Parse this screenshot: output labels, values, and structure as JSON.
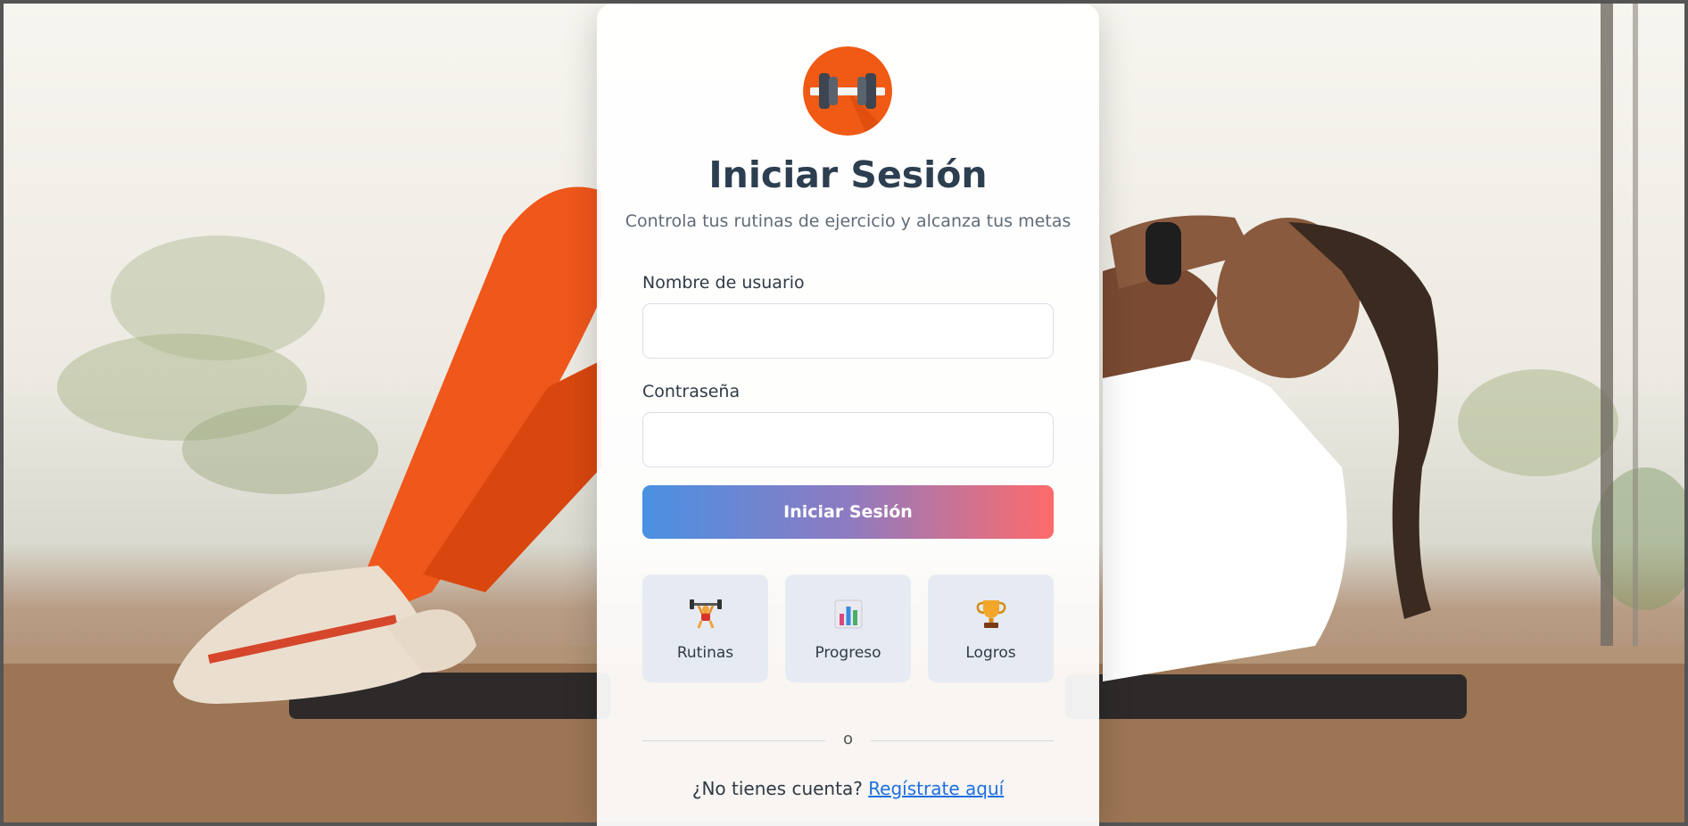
{
  "login": {
    "title": "Iniciar Sesión",
    "subtitle": "Controla tus rutinas de ejercicio y alcanza tus metas",
    "username_label": "Nombre de usuario",
    "username_value": "",
    "password_label": "Contraseña",
    "password_value": "",
    "submit_label": "Iniciar Sesión"
  },
  "features": [
    {
      "label": "Rutinas",
      "icon": "weightlifter-icon"
    },
    {
      "label": "Progreso",
      "icon": "bar-chart-icon"
    },
    {
      "label": "Logros",
      "icon": "trophy-icon"
    }
  ],
  "divider": {
    "text": "o"
  },
  "footer": {
    "question": "¿No tienes cuenta?",
    "link": "Regístrate aquí"
  },
  "colors": {
    "title": "#2c3e50",
    "link": "#1d6fe0",
    "button_gradient_start": "#4a90e2",
    "button_gradient_end": "#ff6b6b",
    "logo": "#f05a14"
  }
}
